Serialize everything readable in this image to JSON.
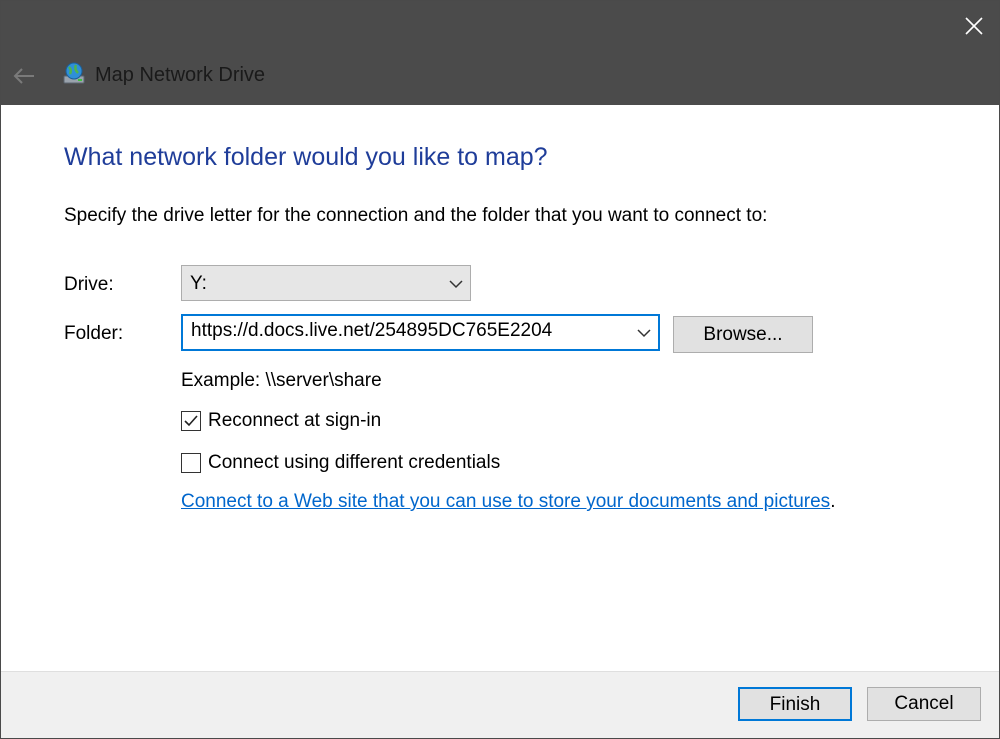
{
  "window": {
    "title": "Map Network Drive",
    "icons": {
      "back": "back-arrow-icon",
      "close": "close-icon",
      "app": "network-drive-icon"
    }
  },
  "main": {
    "heading": "What network folder would you like to map?",
    "instruction": "Specify the drive letter for the connection and the folder that you want to connect to:",
    "drive": {
      "label": "Drive:",
      "value": "Y:"
    },
    "folder": {
      "label": "Folder:",
      "value": "https://d.docs.live.net/254895DC765E2204",
      "browse_label": "Browse..."
    },
    "example": "Example: \\\\server\\share",
    "reconnect": {
      "label": "Reconnect at sign-in",
      "checked": true
    },
    "credentials": {
      "label": "Connect using different credentials",
      "checked": false
    },
    "link": {
      "text": "Connect to a Web site that you can use to store your documents and pictures",
      "suffix": "."
    }
  },
  "footer": {
    "finish_label": "Finish",
    "cancel_label": "Cancel"
  },
  "colors": {
    "heading": "#1f3d99",
    "accent": "#0078d7",
    "link": "#0066cc",
    "titlebar": "#4b4b4b"
  }
}
